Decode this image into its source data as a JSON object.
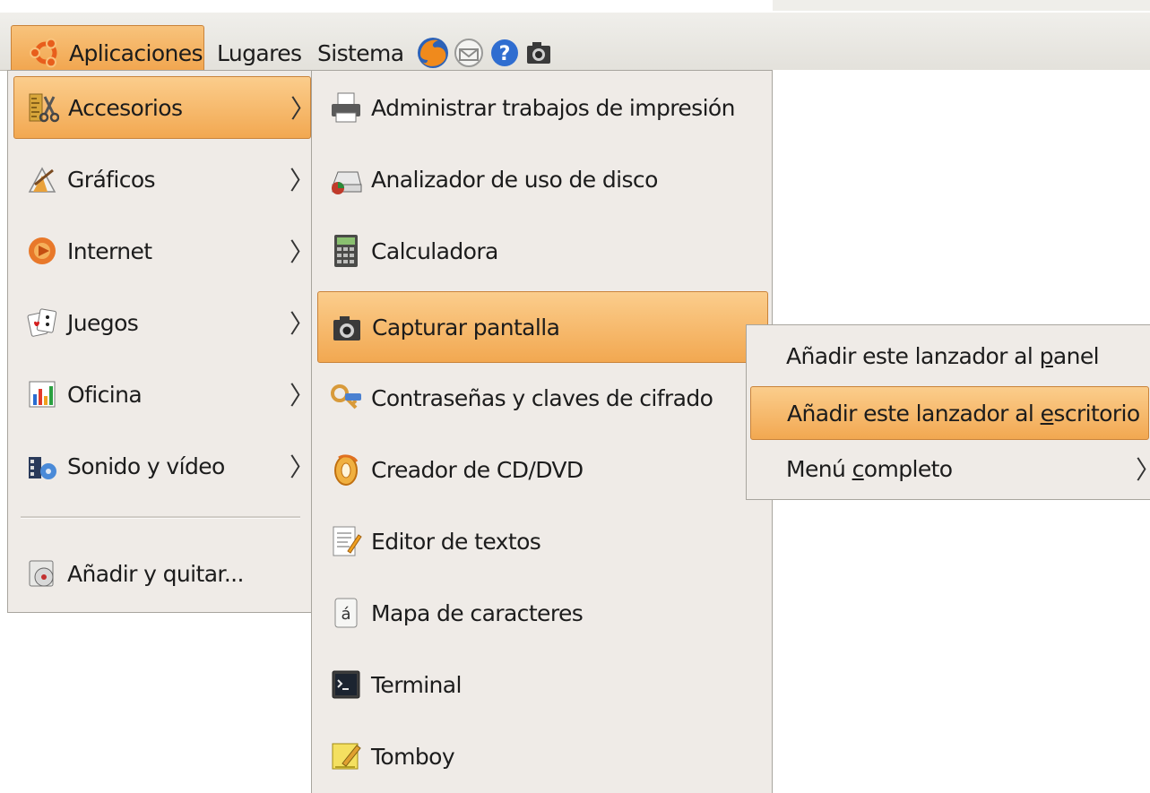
{
  "panel": {
    "menus": [
      {
        "label": "Aplicaciones"
      },
      {
        "label": "Lugares"
      },
      {
        "label": "Sistema"
      }
    ],
    "launchers": [
      "firefox-icon",
      "mail-icon",
      "help-icon",
      "screenshot-icon"
    ]
  },
  "main_menu": {
    "items": [
      {
        "label": "Accesorios",
        "icon": "accessories-icon",
        "submenu": true,
        "highlighted": true
      },
      {
        "label": "Gráficos",
        "icon": "graphics-icon",
        "submenu": true
      },
      {
        "label": "Internet",
        "icon": "internet-icon",
        "submenu": true
      },
      {
        "label": "Juegos",
        "icon": "games-icon",
        "submenu": true
      },
      {
        "label": "Oficina",
        "icon": "office-icon",
        "submenu": true
      },
      {
        "label": "Sonido y vídeo",
        "icon": "sound-video-icon",
        "submenu": true
      }
    ],
    "add_remove": {
      "label": "Añadir y quitar...",
      "icon": "add-remove-icon"
    },
    "arrow": "〉"
  },
  "accessories_menu": {
    "items": [
      {
        "label": "Administrar trabajos de impresión",
        "icon": "printer-icon"
      },
      {
        "label": "Analizador de uso de disco",
        "icon": "disk-usage-icon"
      },
      {
        "label": "Calculadora",
        "icon": "calculator-icon"
      },
      {
        "label": "Capturar pantalla",
        "icon": "camera-icon",
        "highlighted": true
      },
      {
        "label": "Contraseñas y claves de cifrado",
        "icon": "keys-icon"
      },
      {
        "label": "Creador de CD/DVD",
        "icon": "cd-burner-icon"
      },
      {
        "label": "Editor de textos",
        "icon": "text-editor-icon"
      },
      {
        "label": "Mapa de caracteres",
        "icon": "char-map-icon"
      },
      {
        "label": "Terminal",
        "icon": "terminal-icon"
      },
      {
        "label": "Tomboy",
        "icon": "tomboy-icon"
      }
    ]
  },
  "context_menu": {
    "items": [
      {
        "pre": "Añadir este lanzador al ",
        "mn": "p",
        "post": "anel"
      },
      {
        "pre": "Añadir este lanzador al ",
        "mn": "e",
        "post": "scritorio",
        "highlighted": true
      },
      {
        "pre": "Menú ",
        "mn": "c",
        "post": "ompleto",
        "submenu": true
      }
    ],
    "arrow": "〉"
  },
  "colors": {
    "highlight": "#f2a851",
    "menu_bg": "#efebe7",
    "panel_bg": "#e8e6e0"
  }
}
